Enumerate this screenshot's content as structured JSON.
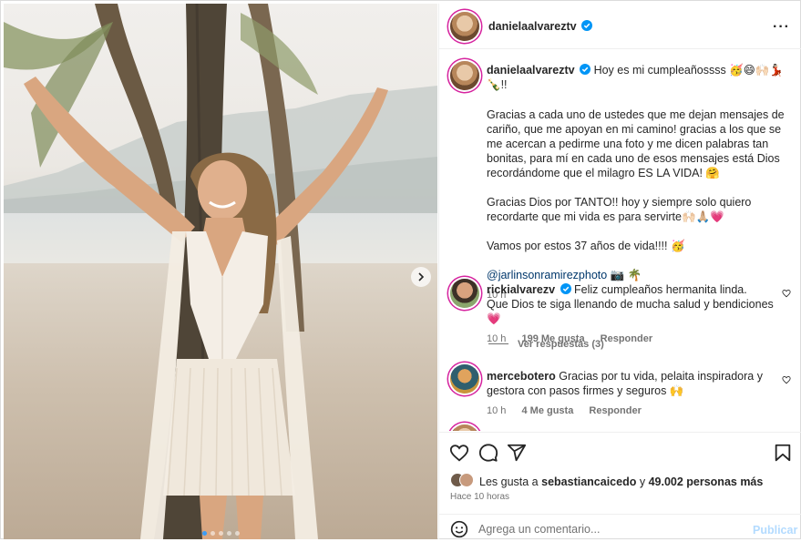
{
  "post": {
    "username": "danielaalvareztv",
    "caption_paragraphs": [
      "Gracias a cada uno de ustedes que me dejan mensajes de cariño, que me apoyan en mi camino! gracias a los que se me acercan a pedirme una foto y me dicen palabras tan bonitas, para mí en cada uno de esos mensajes está Dios recordándome que el milagro ES LA VIDA! 🤗",
      "Gracias Dios por TANTO!! hoy y siempre solo quiero recordarte que mi vida es para servirte🙌🏻🙏🏼💗",
      "Vamos por estos 37 años de vida!!!! 🥳"
    ],
    "caption_first": "Hoy es mi cumpleañossss 🥳😄🙌🏻💃🏻🍾!!",
    "photo_credit": "@jarlinsonramirezphoto",
    "photo_credit_suffix": "📷 🌴",
    "caption_time": "10 h",
    "likes_prefix": "Les gusta a",
    "likes_user": "sebastiancaicedo",
    "likes_suffix": "y",
    "likes_count": "49.002 personas más",
    "posted_ago": "Hace 10 horas",
    "carousel_count": 5,
    "carousel_active": 0
  },
  "comments": [
    {
      "username": "rickialvarezv",
      "text": "Feliz cumpleaños hermanita linda.\nQue Dios te siga llenando de mucha salud y bendiciones💗",
      "time": "10 h",
      "likes": "199 Me gusta",
      "reply": "Responder",
      "view_replies": "Ver respuestas (3)"
    },
    {
      "username": "mercebotero",
      "text": "Gracias por tu vida, pelaita inspiradora y gestora con pasos firmes y seguros 🙌",
      "time": "10 h",
      "likes": "4 Me gusta",
      "reply": "Responder"
    }
  ],
  "composer": {
    "placeholder": "Agrega un comentario...",
    "publish_label": "Publicar"
  },
  "icons": {
    "more": "more-options-icon",
    "verified": "verified-badge-icon",
    "like": "heart-icon",
    "comment": "comment-bubble-icon",
    "share": "send-icon",
    "save": "bookmark-icon",
    "emoji": "emoji-icon",
    "next": "chevron-right-icon"
  },
  "colors": {
    "verified": "#0095f6",
    "link": "#00376b",
    "publish_disabled": "#b3dbff",
    "muted": "#737373",
    "comment_heart": "#ff3040"
  }
}
